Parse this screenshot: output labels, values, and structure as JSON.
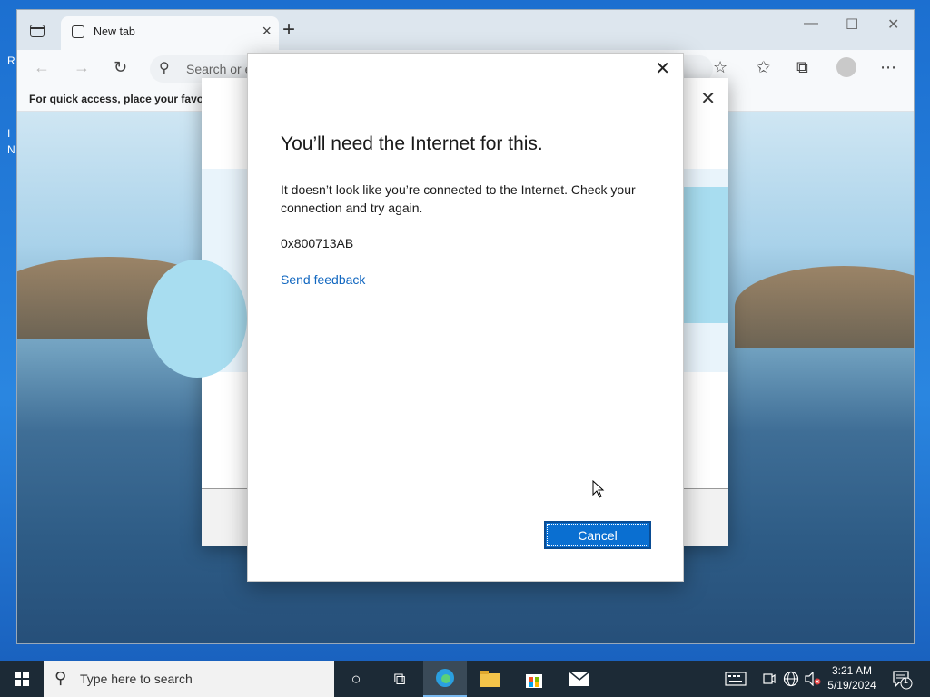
{
  "desktop": {
    "icon_labels": [
      "R",
      "I",
      "N"
    ]
  },
  "browser": {
    "tab": {
      "label": "New tab",
      "close": "×"
    },
    "new_tab": "+",
    "window_controls": {
      "minimize": "—",
      "maximize": "☐",
      "close": "✕"
    },
    "toolbar": {
      "back": "←",
      "forward": "→",
      "refresh": "↻",
      "search_icon": "⚲",
      "address_placeholder": "Search or e",
      "add_favorite": "☆",
      "favorites": "✩",
      "collections": "⧉",
      "more": "⋯"
    },
    "favorites_bar_text": "For quick access, place your favorit"
  },
  "back_dialog": {
    "close": "✕"
  },
  "dialog": {
    "close": "✕",
    "title": "You’ll need the Internet for this.",
    "message": "It doesn’t look like you’re connected to the Internet. Check your connection and try again.",
    "error_code": "0x800713AB",
    "feedback_link": "Send feedback",
    "cancel_label": "Cancel"
  },
  "taskbar": {
    "search_placeholder": "Type here to search",
    "search_icon": "⚲",
    "task_view_icon": "○",
    "timeline_icon": "⧉",
    "clock_time": "3:21 AM",
    "clock_date": "5/19/2024",
    "notification_count": "1"
  }
}
